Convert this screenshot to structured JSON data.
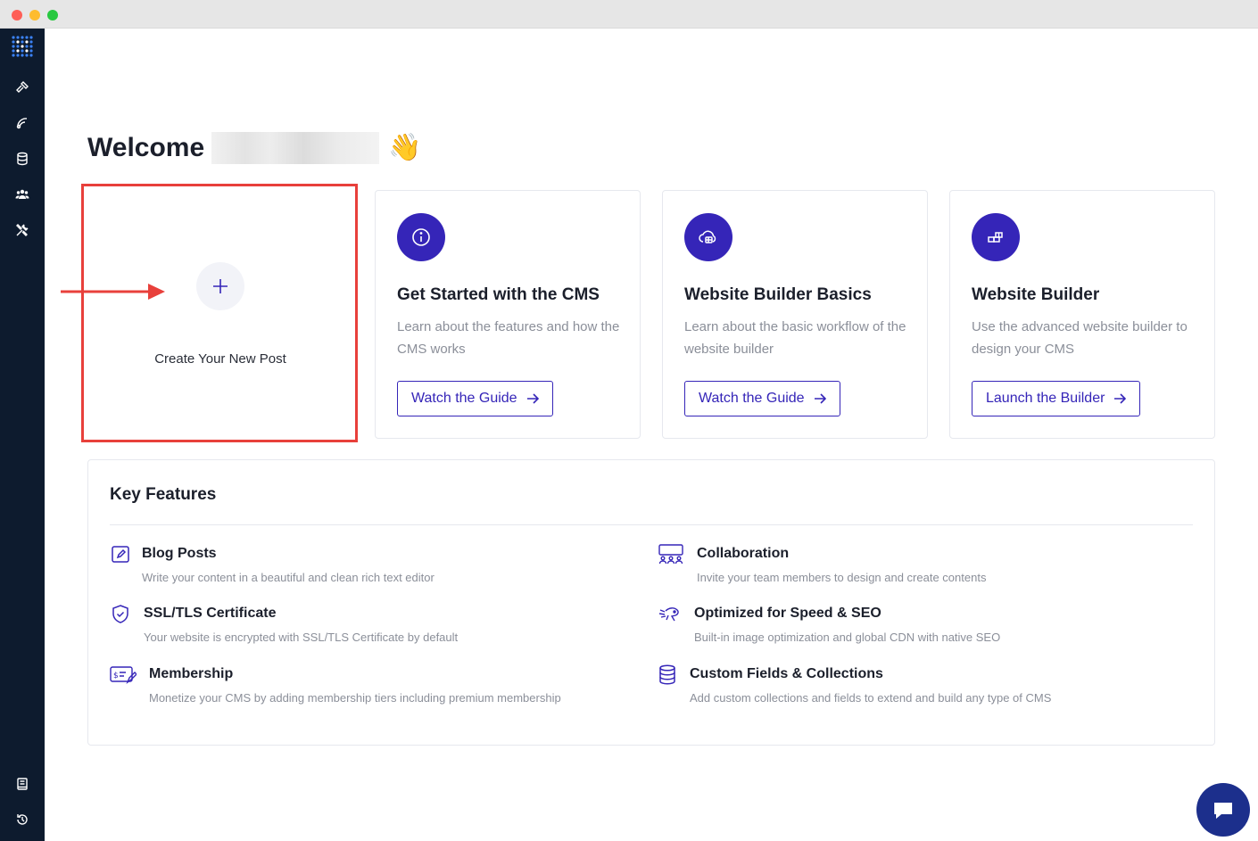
{
  "window": {
    "controls": [
      "close",
      "minimize",
      "maximize"
    ]
  },
  "sidebar": {
    "logo": "app-logo-icon",
    "top_items": [
      {
        "icon": "hammer-icon"
      },
      {
        "icon": "integration-icon"
      },
      {
        "icon": "database-icon"
      },
      {
        "icon": "team-icon"
      },
      {
        "icon": "tools-icon"
      }
    ],
    "bottom_items": [
      {
        "icon": "book-icon"
      },
      {
        "icon": "history-icon"
      }
    ]
  },
  "header": {
    "welcome": "Welcome",
    "wave_emoji": "👋"
  },
  "create_card": {
    "label": "Create Your New Post",
    "icon": "plus-icon"
  },
  "cards": [
    {
      "icon": "info-icon",
      "title": "Get Started with the CMS",
      "description": "Learn about the features and how the CMS works",
      "button": "Watch the Guide"
    },
    {
      "icon": "cloud-builder-icon",
      "title": "Website Builder Basics",
      "description": "Learn about the basic workflow of the website builder",
      "button": "Watch the Guide"
    },
    {
      "icon": "blocks-icon",
      "title": "Website Builder",
      "description": "Use the advanced website builder to design your CMS",
      "button": "Launch the Builder"
    }
  ],
  "key_features": {
    "title": "Key Features",
    "items": [
      {
        "icon": "edit-icon",
        "title": "Blog Posts",
        "description": "Write your content in a beautiful and clean rich text editor"
      },
      {
        "icon": "collaboration-icon",
        "title": "Collaboration",
        "description": "Invite your team members to design and create contents"
      },
      {
        "icon": "shield-check-icon",
        "title": "SSL/TLS Certificate",
        "description": "Your website is encrypted with SSL/TLS Certificate by default"
      },
      {
        "icon": "speed-icon",
        "title": "Optimized for Speed & SEO",
        "description": "Built-in image optimization and global CDN with native SEO"
      },
      {
        "icon": "membership-icon",
        "title": "Membership",
        "description": "Monetize your CMS by adding membership tiers including premium membership"
      },
      {
        "icon": "database-icon",
        "title": "Custom Fields & Collections",
        "description": "Add custom collections and fields to extend and build any type of CMS"
      }
    ]
  },
  "chat": {
    "icon": "chat-icon"
  },
  "colors": {
    "accent": "#3525b8",
    "sidebar": "#0d1b2e",
    "highlight": "#e8403b",
    "chat": "#1c2f8c"
  }
}
